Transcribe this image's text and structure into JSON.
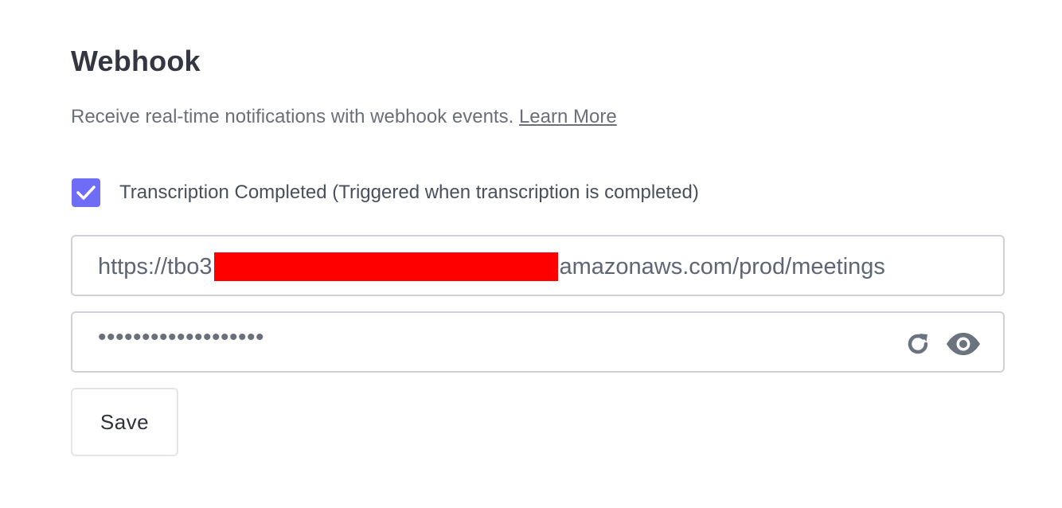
{
  "header": {
    "title": "Webhook"
  },
  "description": {
    "text": "Receive real-time notifications with webhook events.",
    "link_label": "Learn More"
  },
  "event": {
    "checked": true,
    "label": "Transcription Completed (Triggered when transcription is completed)"
  },
  "url_field": {
    "prefix": "https://tbo3",
    "suffix": "amazonaws.com/prod/meetings"
  },
  "secret_field": {
    "masked_value": "•••••••••••••••••••",
    "icons": [
      "refresh-icon",
      "eye-icon"
    ]
  },
  "actions": {
    "save_label": "Save"
  },
  "colors": {
    "checkbox_accent": "#6f6cf5",
    "redaction": "#ff0000",
    "icon_color": "#6b7280"
  }
}
